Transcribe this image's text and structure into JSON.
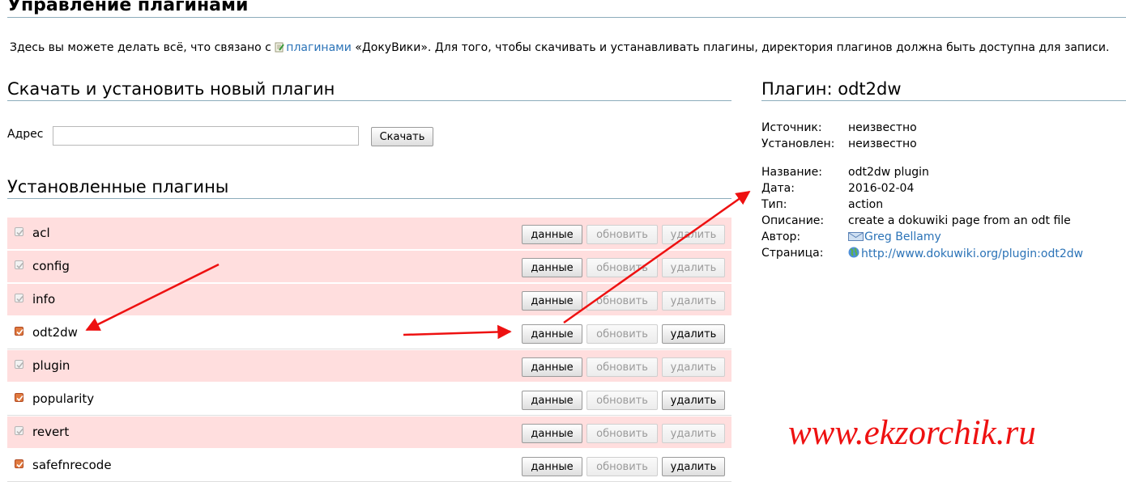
{
  "page": {
    "title": "Управление плагинами",
    "intro_before": "Здесь вы можете делать всё, что связано с ",
    "intro_link": "плагинами",
    "intro_after": " «ДокуВики». Для того, чтобы скачивать и устанавливать плагины, директория плагинов должна быть доступна для записи."
  },
  "download": {
    "heading": "Скачать и установить новый плагин",
    "address_label": "Адрес",
    "address_value": "",
    "download_button": "Скачать"
  },
  "installed": {
    "heading": "Установленные плагины",
    "buttons": {
      "info": "данные",
      "update": "обновить",
      "delete": "удалить"
    },
    "plugins": [
      {
        "name": "acl",
        "protected": true
      },
      {
        "name": "config",
        "protected": true
      },
      {
        "name": "info",
        "protected": true
      },
      {
        "name": "odt2dw",
        "protected": false
      },
      {
        "name": "plugin",
        "protected": true
      },
      {
        "name": "popularity",
        "protected": false
      },
      {
        "name": "revert",
        "protected": true
      },
      {
        "name": "safefnrecode",
        "protected": false
      }
    ]
  },
  "plugin_info": {
    "heading": "Плагин: odt2dw",
    "source_label": "Источник:",
    "source_value": "неизвестно",
    "installed_label": "Установлен:",
    "installed_value": "неизвестно",
    "name_label": "Название:",
    "name_value": "odt2dw plugin",
    "date_label": "Дата:",
    "date_value": "2016-02-04",
    "type_label": "Тип:",
    "type_value": "action",
    "description_label": "Описание:",
    "description_value": "create a dokuwiki page from an odt file",
    "author_label": "Автор:",
    "author_value": "Greg Bellamy",
    "page_label": "Страница:",
    "page_value": "http://www.dokuwiki.org/plugin:odt2dw"
  },
  "watermark": "www.ekzorchik.ru",
  "colors": {
    "protected_row": "#ffdede",
    "link": "#2b73b7",
    "rule": "#8cacbb",
    "annotation_arrow": "#ee1111",
    "enabled_checkbox": "#e07a3f"
  }
}
